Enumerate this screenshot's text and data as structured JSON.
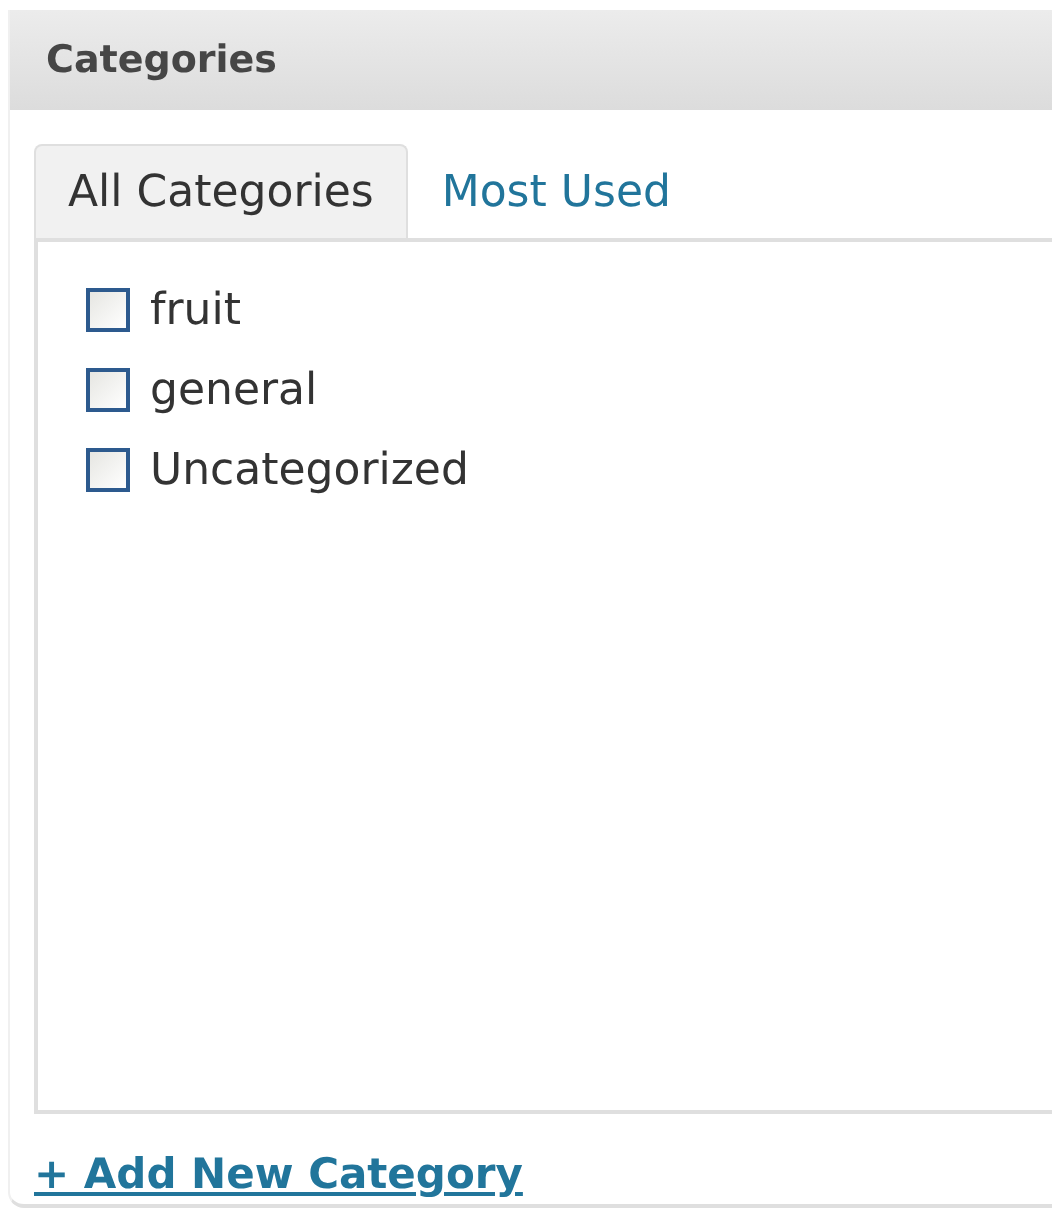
{
  "box": {
    "title": "Categories"
  },
  "tabs": [
    {
      "label": "All Categories",
      "selected": true
    },
    {
      "label": "Most Used",
      "selected": false
    }
  ],
  "categories": [
    {
      "label": "fruit",
      "checked": false
    },
    {
      "label": "general",
      "checked": false
    },
    {
      "label": "Uncategorized",
      "checked": false
    }
  ],
  "add_link": "+ Add New Category"
}
